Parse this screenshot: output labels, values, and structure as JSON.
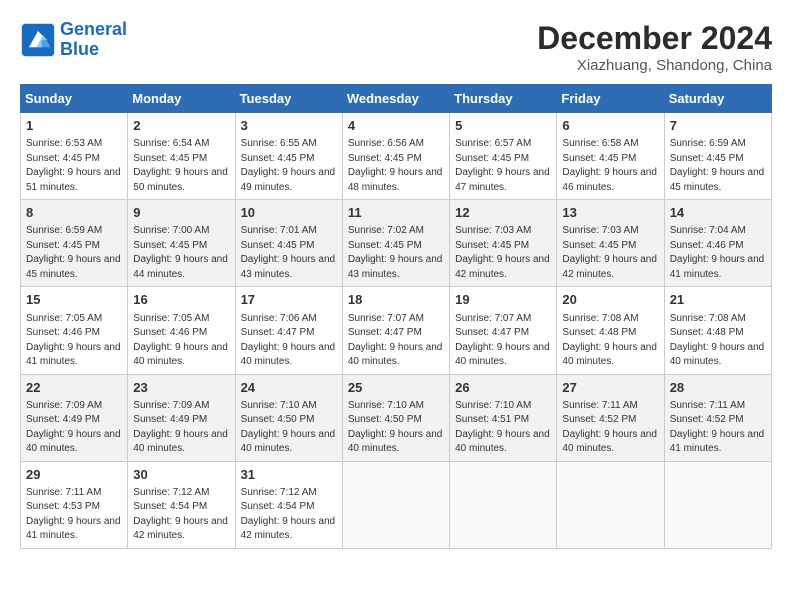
{
  "header": {
    "logo_line1": "General",
    "logo_line2": "Blue",
    "month": "December 2024",
    "location": "Xiazhuang, Shandong, China"
  },
  "days_of_week": [
    "Sunday",
    "Monday",
    "Tuesday",
    "Wednesday",
    "Thursday",
    "Friday",
    "Saturday"
  ],
  "weeks": [
    [
      {
        "day": "1",
        "info": "Sunrise: 6:53 AM\nSunset: 4:45 PM\nDaylight: 9 hours and 51 minutes."
      },
      {
        "day": "2",
        "info": "Sunrise: 6:54 AM\nSunset: 4:45 PM\nDaylight: 9 hours and 50 minutes."
      },
      {
        "day": "3",
        "info": "Sunrise: 6:55 AM\nSunset: 4:45 PM\nDaylight: 9 hours and 49 minutes."
      },
      {
        "day": "4",
        "info": "Sunrise: 6:56 AM\nSunset: 4:45 PM\nDaylight: 9 hours and 48 minutes."
      },
      {
        "day": "5",
        "info": "Sunrise: 6:57 AM\nSunset: 4:45 PM\nDaylight: 9 hours and 47 minutes."
      },
      {
        "day": "6",
        "info": "Sunrise: 6:58 AM\nSunset: 4:45 PM\nDaylight: 9 hours and 46 minutes."
      },
      {
        "day": "7",
        "info": "Sunrise: 6:59 AM\nSunset: 4:45 PM\nDaylight: 9 hours and 45 minutes."
      }
    ],
    [
      {
        "day": "8",
        "info": "Sunrise: 6:59 AM\nSunset: 4:45 PM\nDaylight: 9 hours and 45 minutes."
      },
      {
        "day": "9",
        "info": "Sunrise: 7:00 AM\nSunset: 4:45 PM\nDaylight: 9 hours and 44 minutes."
      },
      {
        "day": "10",
        "info": "Sunrise: 7:01 AM\nSunset: 4:45 PM\nDaylight: 9 hours and 43 minutes."
      },
      {
        "day": "11",
        "info": "Sunrise: 7:02 AM\nSunset: 4:45 PM\nDaylight: 9 hours and 43 minutes."
      },
      {
        "day": "12",
        "info": "Sunrise: 7:03 AM\nSunset: 4:45 PM\nDaylight: 9 hours and 42 minutes."
      },
      {
        "day": "13",
        "info": "Sunrise: 7:03 AM\nSunset: 4:45 PM\nDaylight: 9 hours and 42 minutes."
      },
      {
        "day": "14",
        "info": "Sunrise: 7:04 AM\nSunset: 4:46 PM\nDaylight: 9 hours and 41 minutes."
      }
    ],
    [
      {
        "day": "15",
        "info": "Sunrise: 7:05 AM\nSunset: 4:46 PM\nDaylight: 9 hours and 41 minutes."
      },
      {
        "day": "16",
        "info": "Sunrise: 7:05 AM\nSunset: 4:46 PM\nDaylight: 9 hours and 40 minutes."
      },
      {
        "day": "17",
        "info": "Sunrise: 7:06 AM\nSunset: 4:47 PM\nDaylight: 9 hours and 40 minutes."
      },
      {
        "day": "18",
        "info": "Sunrise: 7:07 AM\nSunset: 4:47 PM\nDaylight: 9 hours and 40 minutes."
      },
      {
        "day": "19",
        "info": "Sunrise: 7:07 AM\nSunset: 4:47 PM\nDaylight: 9 hours and 40 minutes."
      },
      {
        "day": "20",
        "info": "Sunrise: 7:08 AM\nSunset: 4:48 PM\nDaylight: 9 hours and 40 minutes."
      },
      {
        "day": "21",
        "info": "Sunrise: 7:08 AM\nSunset: 4:48 PM\nDaylight: 9 hours and 40 minutes."
      }
    ],
    [
      {
        "day": "22",
        "info": "Sunrise: 7:09 AM\nSunset: 4:49 PM\nDaylight: 9 hours and 40 minutes."
      },
      {
        "day": "23",
        "info": "Sunrise: 7:09 AM\nSunset: 4:49 PM\nDaylight: 9 hours and 40 minutes."
      },
      {
        "day": "24",
        "info": "Sunrise: 7:10 AM\nSunset: 4:50 PM\nDaylight: 9 hours and 40 minutes."
      },
      {
        "day": "25",
        "info": "Sunrise: 7:10 AM\nSunset: 4:50 PM\nDaylight: 9 hours and 40 minutes."
      },
      {
        "day": "26",
        "info": "Sunrise: 7:10 AM\nSunset: 4:51 PM\nDaylight: 9 hours and 40 minutes."
      },
      {
        "day": "27",
        "info": "Sunrise: 7:11 AM\nSunset: 4:52 PM\nDaylight: 9 hours and 40 minutes."
      },
      {
        "day": "28",
        "info": "Sunrise: 7:11 AM\nSunset: 4:52 PM\nDaylight: 9 hours and 41 minutes."
      }
    ],
    [
      {
        "day": "29",
        "info": "Sunrise: 7:11 AM\nSunset: 4:53 PM\nDaylight: 9 hours and 41 minutes."
      },
      {
        "day": "30",
        "info": "Sunrise: 7:12 AM\nSunset: 4:54 PM\nDaylight: 9 hours and 42 minutes."
      },
      {
        "day": "31",
        "info": "Sunrise: 7:12 AM\nSunset: 4:54 PM\nDaylight: 9 hours and 42 minutes."
      },
      null,
      null,
      null,
      null
    ]
  ]
}
